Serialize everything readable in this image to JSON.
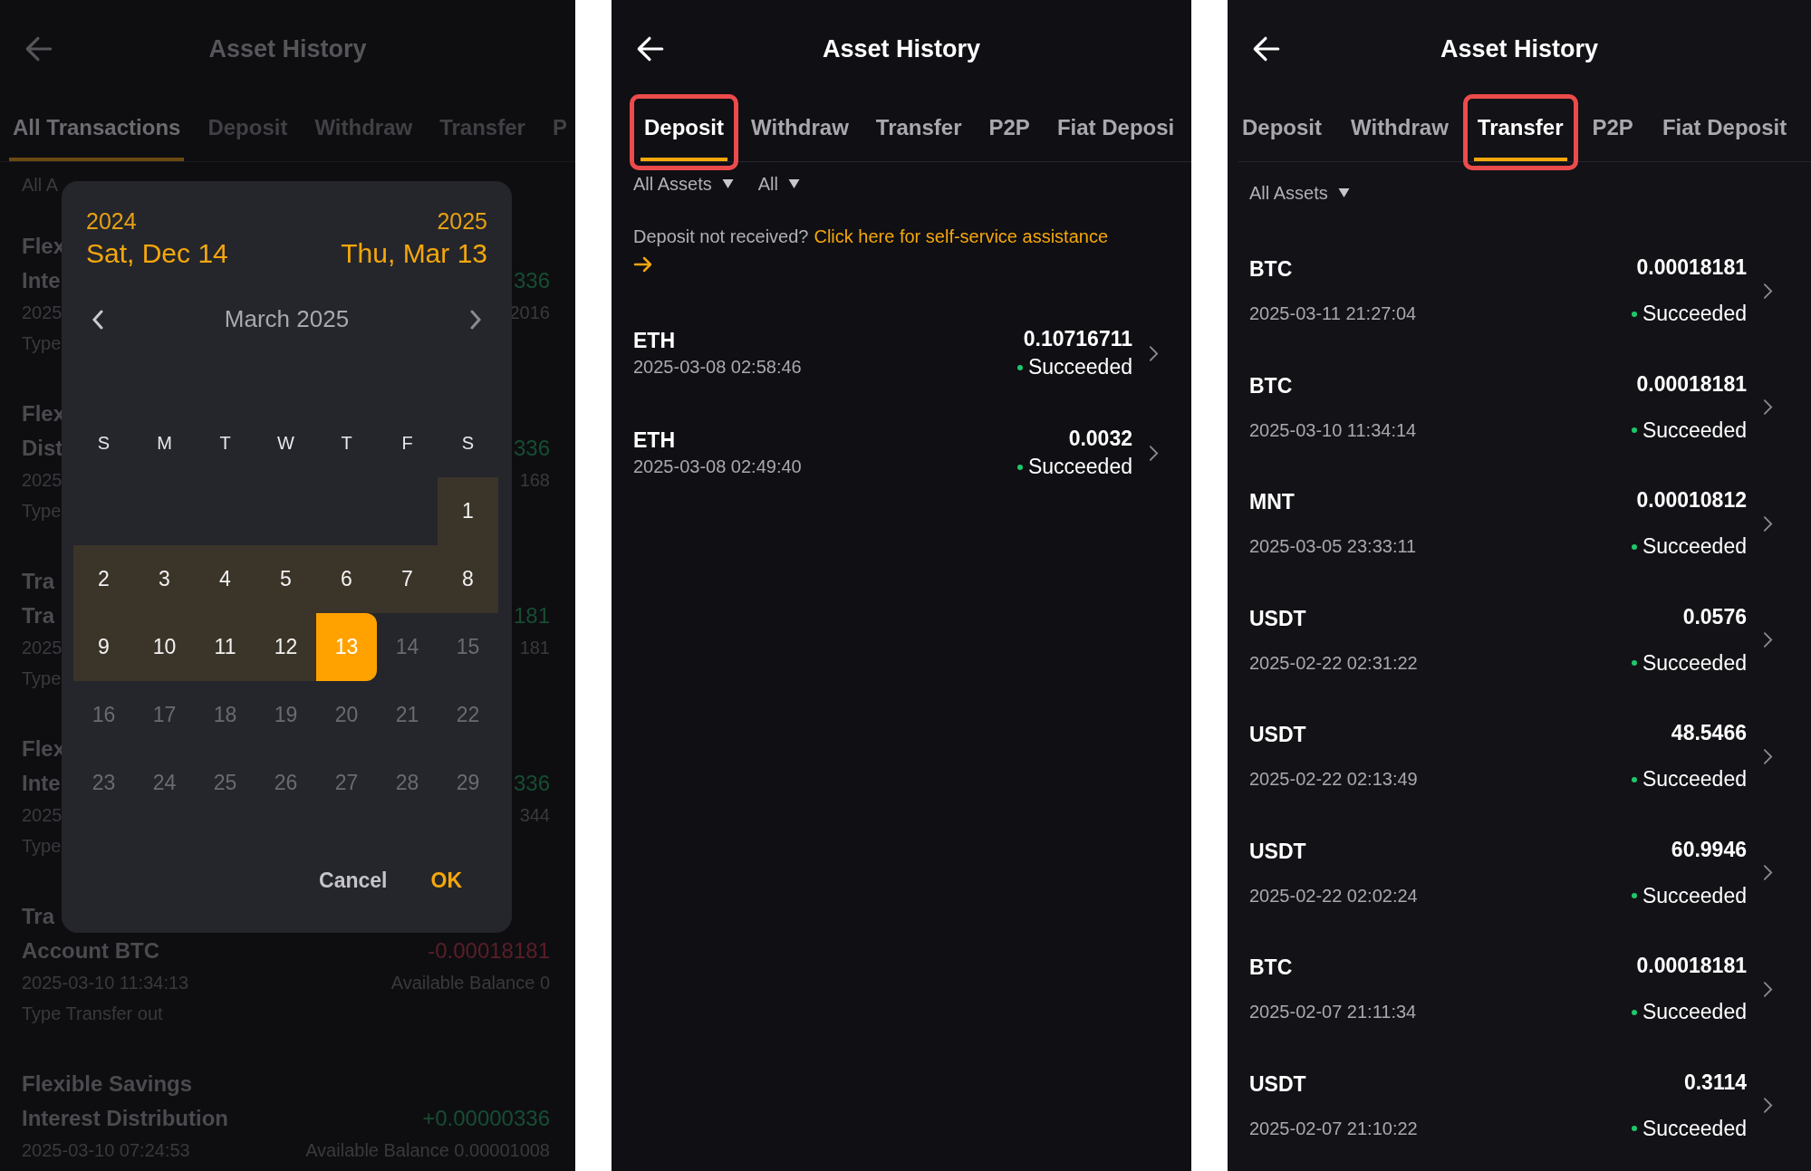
{
  "all_transactions_screen": {
    "title": "Asset History",
    "tabs": [
      {
        "label": "All Transactions",
        "selected": true
      },
      {
        "label": "Deposit",
        "selected": false
      },
      {
        "label": "Withdraw",
        "selected": false
      },
      {
        "label": "Transfer",
        "selected": false
      },
      {
        "label": "P",
        "selected": false
      }
    ],
    "filter": "All A",
    "records": [
      {
        "lines": [
          "Flex",
          "Inte",
          "2025",
          "Type"
        ],
        "amount": "336",
        "balance": "2016",
        "kind": "credit"
      },
      {
        "lines": [
          "Flex",
          "Dist",
          "2025",
          "Type"
        ],
        "amount": "336",
        "balance": "168",
        "kind": "credit"
      },
      {
        "lines": [
          "Tra",
          "Tra",
          "2025",
          "Type"
        ],
        "amount": "181",
        "balance": "181",
        "kind": "credit"
      },
      {
        "lines": [
          "Flex",
          "Inte",
          "2025",
          "Type"
        ],
        "amount": "336",
        "balance": "344",
        "kind": "credit"
      },
      {
        "lines": [
          "Tra",
          "Account BTC",
          "2025-03-10 11:34:13",
          "Type Transfer out"
        ],
        "amount": "-0.00018181",
        "balance": "Available Balance 0",
        "kind": "debit"
      },
      {
        "lines": [
          "Flexible Savings",
          "Interest Distribution",
          "2025-03-10 07:24:53"
        ],
        "amount": "+0.00000336",
        "balance": "Available Balance 0.00001008",
        "kind": "credit"
      }
    ],
    "date_picker": {
      "start_year": "2024",
      "start_date": "Sat, Dec 14",
      "end_year": "2025",
      "end_date": "Thu, Mar 13",
      "month": "March 2025",
      "weekdays": [
        "S",
        "M",
        "T",
        "W",
        "T",
        "F",
        "S"
      ],
      "weeks": [
        [
          {
            "kind": "blank"
          },
          {
            "kind": "blank"
          },
          {
            "kind": "blank"
          },
          {
            "kind": "blank"
          },
          {
            "kind": "blank"
          },
          {
            "kind": "blank"
          },
          {
            "kind": "day",
            "label": "1",
            "in_range": true,
            "selected": false,
            "disabled": false
          }
        ],
        [
          {
            "kind": "day",
            "label": "2",
            "in_range": true,
            "selected": false,
            "disabled": false
          },
          {
            "kind": "day",
            "label": "3",
            "in_range": true,
            "selected": false,
            "disabled": false
          },
          {
            "kind": "day",
            "label": "4",
            "in_range": true,
            "selected": false,
            "disabled": false
          },
          {
            "kind": "day",
            "label": "5",
            "in_range": true,
            "selected": false,
            "disabled": false
          },
          {
            "kind": "day",
            "label": "6",
            "in_range": true,
            "selected": false,
            "disabled": false
          },
          {
            "kind": "day",
            "label": "7",
            "in_range": true,
            "selected": false,
            "disabled": false
          },
          {
            "kind": "day",
            "label": "8",
            "in_range": true,
            "selected": false,
            "disabled": false
          }
        ],
        [
          {
            "kind": "day",
            "label": "9",
            "in_range": true,
            "selected": false,
            "disabled": false
          },
          {
            "kind": "day",
            "label": "10",
            "in_range": true,
            "selected": false,
            "disabled": false
          },
          {
            "kind": "day",
            "label": "11",
            "in_range": true,
            "selected": false,
            "disabled": false
          },
          {
            "kind": "day",
            "label": "12",
            "in_range": true,
            "selected": false,
            "disabled": false
          },
          {
            "kind": "day",
            "label": "13",
            "in_range": true,
            "selected": true,
            "disabled": false
          },
          {
            "kind": "day",
            "label": "14",
            "in_range": false,
            "selected": false,
            "disabled": true
          },
          {
            "kind": "day",
            "label": "15",
            "in_range": false,
            "selected": false,
            "disabled": true
          }
        ],
        [
          {
            "kind": "day",
            "label": "16",
            "in_range": false,
            "selected": false,
            "disabled": true
          },
          {
            "kind": "day",
            "label": "17",
            "in_range": false,
            "selected": false,
            "disabled": true
          },
          {
            "kind": "day",
            "label": "18",
            "in_range": false,
            "selected": false,
            "disabled": true
          },
          {
            "kind": "day",
            "label": "19",
            "in_range": false,
            "selected": false,
            "disabled": true
          },
          {
            "kind": "day",
            "label": "20",
            "in_range": false,
            "selected": false,
            "disabled": true
          },
          {
            "kind": "day",
            "label": "21",
            "in_range": false,
            "selected": false,
            "disabled": true
          },
          {
            "kind": "day",
            "label": "22",
            "in_range": false,
            "selected": false,
            "disabled": true
          }
        ],
        [
          {
            "kind": "day",
            "label": "23",
            "in_range": false,
            "selected": false,
            "disabled": true
          },
          {
            "kind": "day",
            "label": "24",
            "in_range": false,
            "selected": false,
            "disabled": true
          },
          {
            "kind": "day",
            "label": "25",
            "in_range": false,
            "selected": false,
            "disabled": true
          },
          {
            "kind": "day",
            "label": "26",
            "in_range": false,
            "selected": false,
            "disabled": true
          },
          {
            "kind": "day",
            "label": "27",
            "in_range": false,
            "selected": false,
            "disabled": true
          },
          {
            "kind": "day",
            "label": "28",
            "in_range": false,
            "selected": false,
            "disabled": true
          },
          {
            "kind": "day",
            "label": "29",
            "in_range": false,
            "selected": false,
            "disabled": true
          }
        ]
      ],
      "buttons": [
        {
          "label": "Cancel",
          "kind": "secondary"
        },
        {
          "label": "OK",
          "kind": "primary"
        }
      ]
    }
  },
  "deposit_screen": {
    "title": "Asset History",
    "tabs": [
      {
        "label": "Deposit",
        "selected": true,
        "highlighted": true
      },
      {
        "label": "Withdraw",
        "selected": false,
        "highlighted": false
      },
      {
        "label": "Transfer",
        "selected": false,
        "highlighted": false
      },
      {
        "label": "P2P",
        "selected": false,
        "highlighted": false
      },
      {
        "label": "Fiat Deposi",
        "selected": false,
        "highlighted": false
      }
    ],
    "filters": [
      "All Assets",
      "All"
    ],
    "notice": {
      "text": "Deposit not received?",
      "link": "Click here for self-service assistance"
    },
    "records": [
      {
        "asset": "ETH",
        "time": "2025-03-08 02:58:46",
        "amount": "0.10716711",
        "status": "Succeeded"
      },
      {
        "asset": "ETH",
        "time": "2025-03-08 02:49:40",
        "amount": "0.0032",
        "status": "Succeeded"
      }
    ]
  },
  "transfer_screen": {
    "title": "Asset History",
    "tabs": [
      {
        "label": "Deposit",
        "selected": false,
        "highlighted": false
      },
      {
        "label": "Withdraw",
        "selected": false,
        "highlighted": false
      },
      {
        "label": "Transfer",
        "selected": true,
        "highlighted": true
      },
      {
        "label": "P2P",
        "selected": false,
        "highlighted": false
      },
      {
        "label": "Fiat Deposit",
        "selected": false,
        "highlighted": false
      }
    ],
    "filters": [
      "All Assets"
    ],
    "records": [
      {
        "asset": "BTC",
        "time": "2025-03-11 21:27:04",
        "amount": "0.00018181",
        "status": "Succeeded"
      },
      {
        "asset": "BTC",
        "time": "2025-03-10 11:34:14",
        "amount": "0.00018181",
        "status": "Succeeded"
      },
      {
        "asset": "MNT",
        "time": "2025-03-05 23:33:11",
        "amount": "0.00010812",
        "status": "Succeeded"
      },
      {
        "asset": "USDT",
        "time": "2025-02-22 02:31:22",
        "amount": "0.0576",
        "status": "Succeeded"
      },
      {
        "asset": "USDT",
        "time": "2025-02-22 02:13:49",
        "amount": "48.5466",
        "status": "Succeeded"
      },
      {
        "asset": "USDT",
        "time": "2025-02-22 02:02:24",
        "amount": "60.9946",
        "status": "Succeeded"
      },
      {
        "asset": "BTC",
        "time": "2025-02-07 21:11:34",
        "amount": "0.00018181",
        "status": "Succeeded"
      },
      {
        "asset": "USDT",
        "time": "2025-02-07 21:10:22",
        "amount": "0.3114",
        "status": "Succeeded"
      }
    ]
  }
}
